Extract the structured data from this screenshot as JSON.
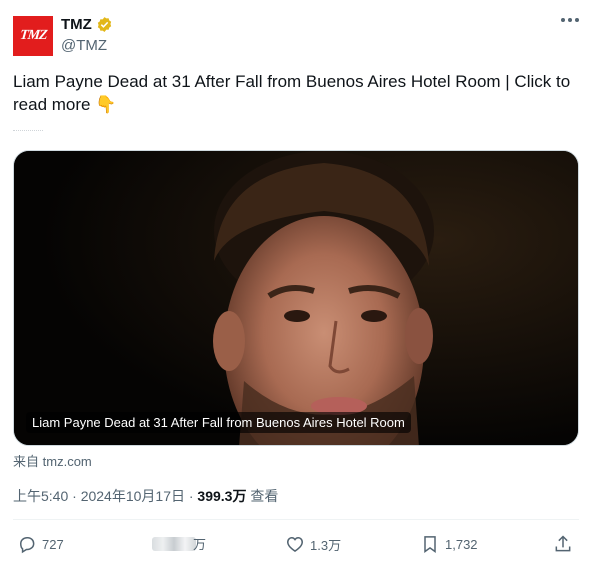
{
  "author": {
    "display_name": "TMZ",
    "handle": "@TMZ",
    "avatar_text": "TMZ",
    "verified_icon": "gold-verified-badge"
  },
  "tweet": {
    "text": "Liam Payne Dead at 31 After Fall from Buenos Aires Hotel Room  | Click to read more",
    "emoji": "👇"
  },
  "card": {
    "caption": "Liam Payne Dead at 31 After Fall from Buenos Aires Hotel Room",
    "source_prefix": "来自",
    "source_domain": "tmz.com"
  },
  "meta": {
    "timestamp": "上午5:40 · 2024年10月17日 · ",
    "views_count": "399.3万",
    "views_label": " 查看"
  },
  "actions": {
    "replies": "727",
    "retweets_partial": "万",
    "likes": "1.3万",
    "bookmarks": "1,732"
  },
  "colors": {
    "brand_red": "#e21d1d",
    "secondary_text": "#536471",
    "primary_text": "#0f1419",
    "verified_gold": "#e2b719"
  }
}
